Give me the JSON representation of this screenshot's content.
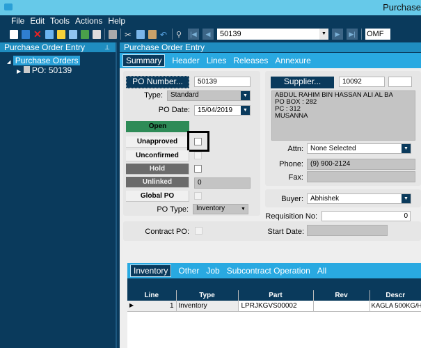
{
  "window": {
    "title": "Purchase"
  },
  "menu": [
    "File",
    "Edit",
    "Tools",
    "Actions",
    "Help"
  ],
  "toolbar": {
    "record_value": "50139",
    "company": "OMF"
  },
  "left_panel": {
    "title": "Purchase Order Entry",
    "tree": {
      "root": "Purchase Orders",
      "child": "PO: 50139"
    }
  },
  "main": {
    "title": "Purchase Order Entry",
    "tabs": [
      "Summary",
      "Header",
      "Lines",
      "Releases",
      "Annexure"
    ],
    "selected_tab": "Summary"
  },
  "form": {
    "po_number_button": "PO Number...",
    "po_number": "50139",
    "type_label": "Type:",
    "type_value": "Standard",
    "po_date_label": "PO Date:",
    "po_date": "15/04/2019",
    "status_open": "Open",
    "unapproved": "Unapproved",
    "unconfirmed": "Unconfirmed",
    "hold": "Hold",
    "unlinked": "Unlinked",
    "unlinked_value": "0",
    "global_po": "Global PO",
    "po_type_label": "PO Type:",
    "po_type_value": "Inventory",
    "contract_po_label": "Contract PO:",
    "supplier_button": "Supplier...",
    "supplier_id": "10092",
    "address": [
      "ABDUL RAHIM BIN HASSAN ALI AL BA",
      "PO BOX : 282",
      "PC : 312",
      "MUSANNA"
    ],
    "attn_label": "Attn:",
    "attn_value": "None Selected",
    "phone_label": "Phone:",
    "phone_value": "(9) 900-2124",
    "fax_label": "Fax:",
    "fax_value": "",
    "buyer_label": "Buyer:",
    "buyer_value": "Abhishek",
    "requisition_label": "Requisition No:",
    "requisition_value": "0",
    "start_date_label": "Start Date:"
  },
  "lines": {
    "tabs": [
      "Inventory",
      "Other",
      "Job",
      "Subcontract Operation",
      "All"
    ],
    "selected_tab": "Inventory",
    "columns": [
      "Line",
      "Type",
      "Part",
      "Rev",
      "Descr"
    ],
    "rows": [
      [
        "1",
        "Inventory",
        "LPRJKGVS00002",
        "",
        "KAGLA 500KG/H"
      ]
    ]
  },
  "colors": {
    "title_bar": "#66c9e9",
    "navy": "#0a3a5c",
    "tab_blue": "#29a9e1",
    "open_green": "#2e8b57",
    "highlight": "#000000"
  }
}
